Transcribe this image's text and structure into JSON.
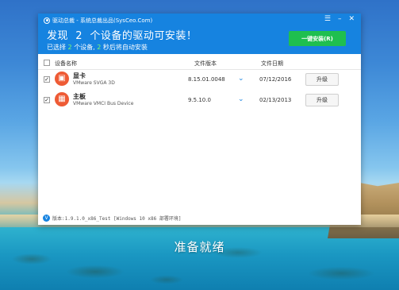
{
  "window": {
    "title": "驱动总裁 - 系统总裁出品(SysCeo.Com)",
    "controls": {
      "menu": "☰",
      "minimize": "–",
      "close": "✕"
    }
  },
  "header": {
    "headline_prefix": "发现",
    "headline_count": "2",
    "headline_suffix": "个设备的驱动可安装！",
    "sub_prefix": "已选择",
    "sub_selected": "2",
    "sub_mid": "个设备,",
    "sub_seconds": "2",
    "sub_suffix": "秒后将自动安装",
    "install_all_label": "一键安装(R)"
  },
  "table": {
    "columns": {
      "device": "设备名称",
      "version": "文件版本",
      "date": "文件日期"
    },
    "rows": [
      {
        "name": "显卡",
        "detail": "VMware SVGA 3D",
        "version": "8.15.01.0048",
        "date": "07/12/2016",
        "action": "升级",
        "icon": "display-card-icon"
      },
      {
        "name": "主板",
        "detail": "VMware VMCI Bus Device",
        "version": "9.5.10.0",
        "date": "02/13/2013",
        "action": "升级",
        "icon": "motherboard-icon"
      }
    ]
  },
  "footer": {
    "version_text": "版本:1.9.1.0_x86_Test [Windows 10 x86 部署环境]"
  },
  "desktop": {
    "status_text": "准备就绪"
  },
  "colors": {
    "header_blue": "#1683e0",
    "install_green": "#1fbf4f",
    "device_icon": "#ee5b35"
  }
}
